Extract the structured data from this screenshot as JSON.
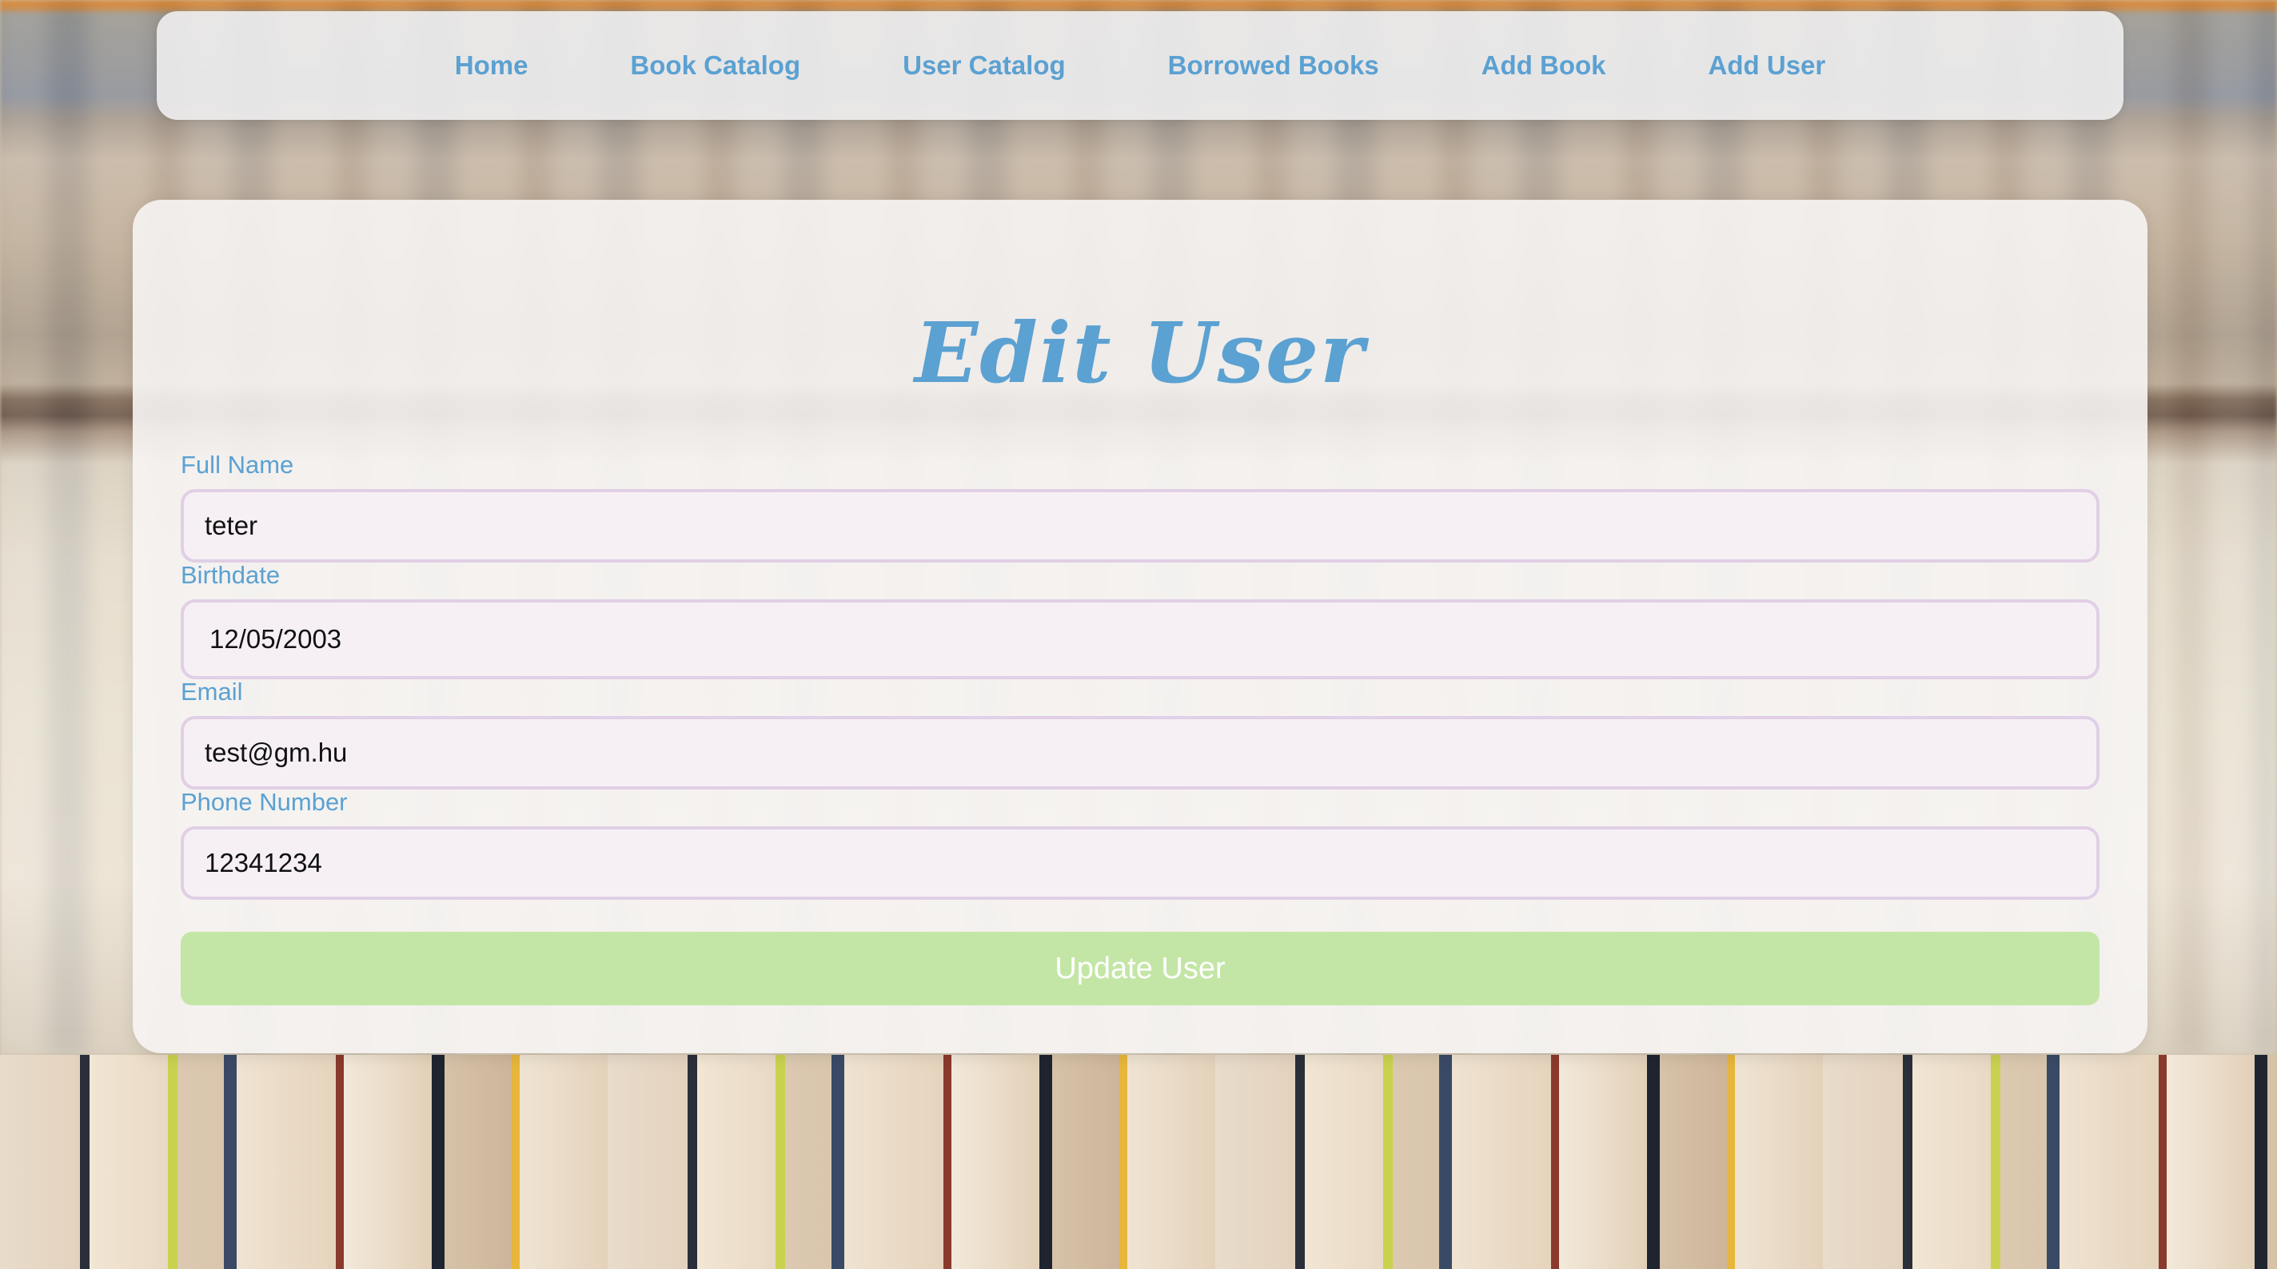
{
  "nav": {
    "items": [
      {
        "label": "Home"
      },
      {
        "label": "Book Catalog"
      },
      {
        "label": "User Catalog"
      },
      {
        "label": "Borrowed Books"
      },
      {
        "label": "Add Book"
      },
      {
        "label": "Add User"
      }
    ]
  },
  "form": {
    "title": "Edit User",
    "fields": {
      "full_name": {
        "label": "Full Name",
        "value": "teter"
      },
      "birthdate": {
        "label": "Birthdate",
        "value": "12/05/2003"
      },
      "email": {
        "label": "Email",
        "value": "test@gm.hu"
      },
      "phone": {
        "label": "Phone Number",
        "value": "12341234"
      }
    },
    "submit_label": "Update User"
  },
  "colors": {
    "accent": "#5ba1d2",
    "button": "#c3e6a6",
    "input_bg": "#f6f0f5",
    "input_border": "#e0cfe6"
  }
}
